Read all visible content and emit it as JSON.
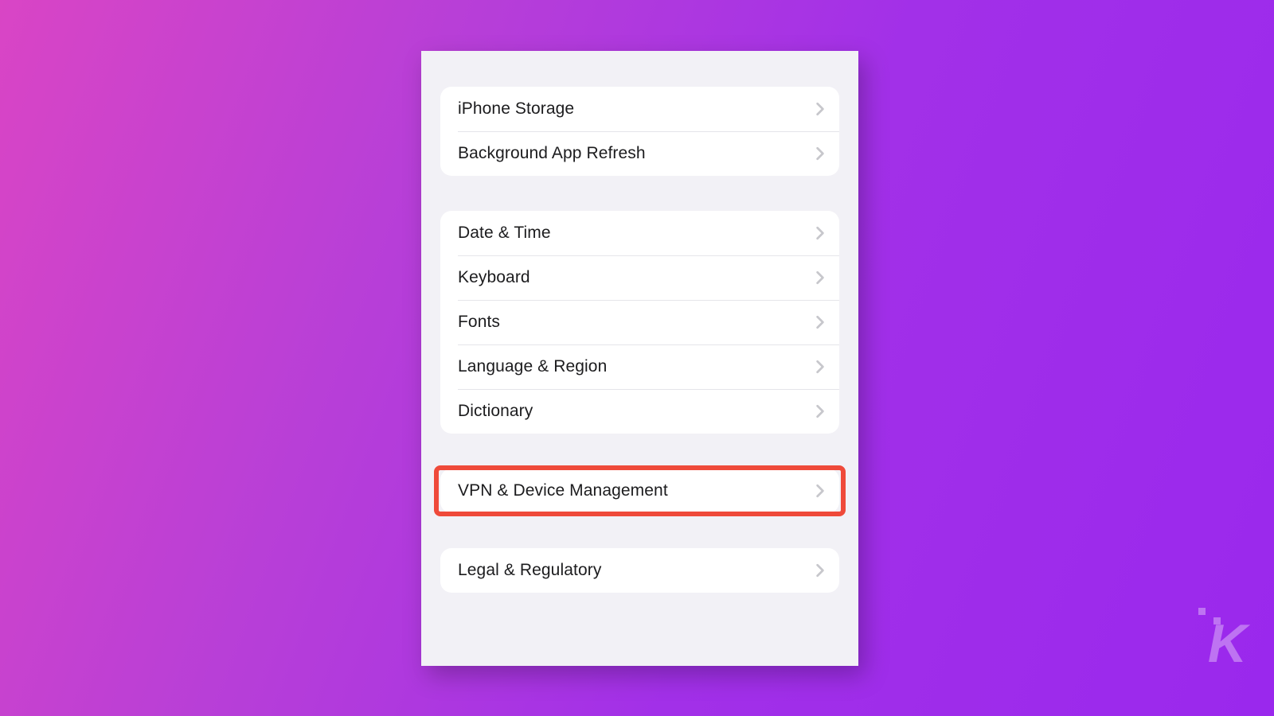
{
  "groups": [
    {
      "name": "storage-group",
      "rows": [
        {
          "key": "iphone-storage",
          "label": "iPhone Storage"
        },
        {
          "key": "background-app-refresh",
          "label": "Background App Refresh"
        }
      ]
    },
    {
      "name": "system-group",
      "rows": [
        {
          "key": "date-time",
          "label": "Date & Time"
        },
        {
          "key": "keyboard",
          "label": "Keyboard"
        },
        {
          "key": "fonts",
          "label": "Fonts"
        },
        {
          "key": "language-region",
          "label": "Language & Region"
        },
        {
          "key": "dictionary",
          "label": "Dictionary"
        }
      ]
    },
    {
      "name": "vpn-group",
      "highlighted": true,
      "rows": [
        {
          "key": "vpn-device-management",
          "label": "VPN & Device Management"
        }
      ]
    },
    {
      "name": "legal-group",
      "rows": [
        {
          "key": "legal-regulatory",
          "label": "Legal & Regulatory"
        }
      ]
    }
  ],
  "watermark": "K"
}
